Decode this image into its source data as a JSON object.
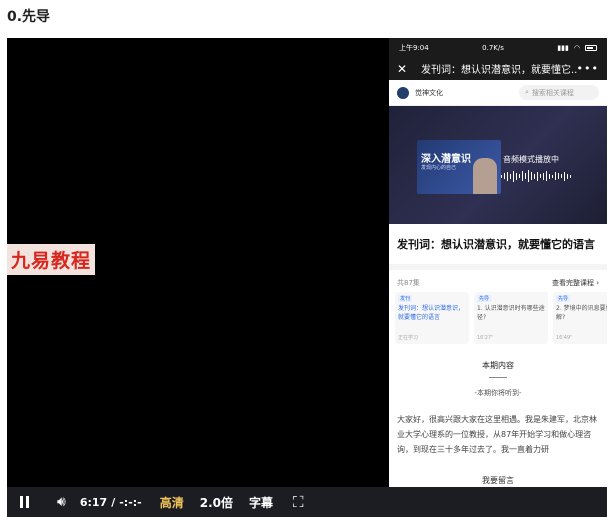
{
  "page": {
    "title": "0.先导"
  },
  "watermark": "九易教程",
  "phone": {
    "status": {
      "time": "上午9:04",
      "network": "0.7K/s",
      "icons": [
        "signal-icon",
        "wifi-icon",
        "battery-icon"
      ]
    },
    "header": {
      "title": "发刊词：想认识潜意识，就要懂它...",
      "close": "✕",
      "more": "•••"
    },
    "brand": {
      "name": "觉神文化",
      "search_placeholder": "搜索相关课程"
    },
    "video": {
      "cover_title": "深入潜意识",
      "cover_sub": "发现内心的自己",
      "mode": "音频模式播放中"
    },
    "lesson_title": "发刊词：想认识潜意识，就要懂它的语言",
    "list": {
      "count": "共87集",
      "link": "查看完整课程",
      "cards": [
        {
          "tag": "发刊",
          "text": "发刊词：想认识潜意识，就要懂它的语言",
          "meta": "正在学习"
        },
        {
          "tag": "先导",
          "text": "1. 认识潜意识时有哪些途径?",
          "meta": "16'27\""
        },
        {
          "tag": "先导",
          "text": "2. 梦境中的讯息要如何理解?",
          "meta": "16'49\""
        }
      ]
    },
    "section_title": "本期内容",
    "subhead": "-本期你将听到-",
    "body": "大家好，很高兴跟大家在这里相遇。我是朱建军，北京林业大学心理系的一位教授，从87年开始学习和做心理咨询，到现在三十多年过去了。我一直着力研",
    "leave_message": "我要留言",
    "nav": [
      "≡",
      "○",
      "‹"
    ]
  },
  "controls": {
    "current_time": "6:17",
    "separator": "/",
    "duration": "-:-:-",
    "quality": "高清",
    "speed": "2.0倍",
    "subtitle": "字幕"
  },
  "colors": {
    "quality_accent": "#f0c35b",
    "watermark_red": "#d9261c",
    "active_blue": "#2b6be8"
  }
}
